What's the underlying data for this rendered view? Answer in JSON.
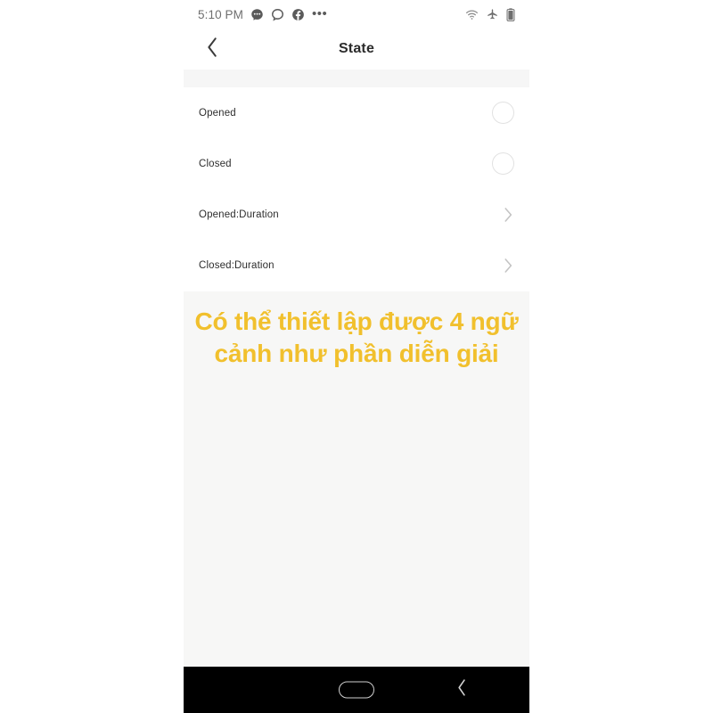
{
  "status_bar": {
    "clock": "5:10 PM",
    "left_icons": [
      {
        "name": "messenger-chat-icon"
      },
      {
        "name": "zalo-icon"
      },
      {
        "name": "facebook-icon"
      },
      {
        "name": "more-dots-icon",
        "glyph": "•••"
      }
    ],
    "right_icons": [
      {
        "name": "wifi-icon"
      },
      {
        "name": "airplane-mode-icon"
      },
      {
        "name": "battery-icon"
      }
    ]
  },
  "header": {
    "title": "State",
    "back_icon": "chevron-left-icon"
  },
  "list": {
    "rows": [
      {
        "label": "Opened",
        "control": "radio",
        "selected": false
      },
      {
        "label": "Closed",
        "control": "radio",
        "selected": false
      },
      {
        "label": "Opened:Duration",
        "control": "chevron"
      },
      {
        "label": "Closed:Duration",
        "control": "chevron"
      }
    ]
  },
  "annotation": {
    "text": "Có thể thiết lập được 4 ngữ cảnh như phần diễn giải",
    "color": "#f1c02d"
  },
  "nav_bar": {
    "home_label": "home-pill",
    "back_label": "back-chevron",
    "background": "#000000"
  },
  "colors": {
    "accent_yellow": "#f1c02d",
    "band_gray": "#f6f6f6",
    "panel_gray": "#f7f7f6",
    "text_dark": "#2d2d2d",
    "radio_border": "#e2e2e2"
  }
}
